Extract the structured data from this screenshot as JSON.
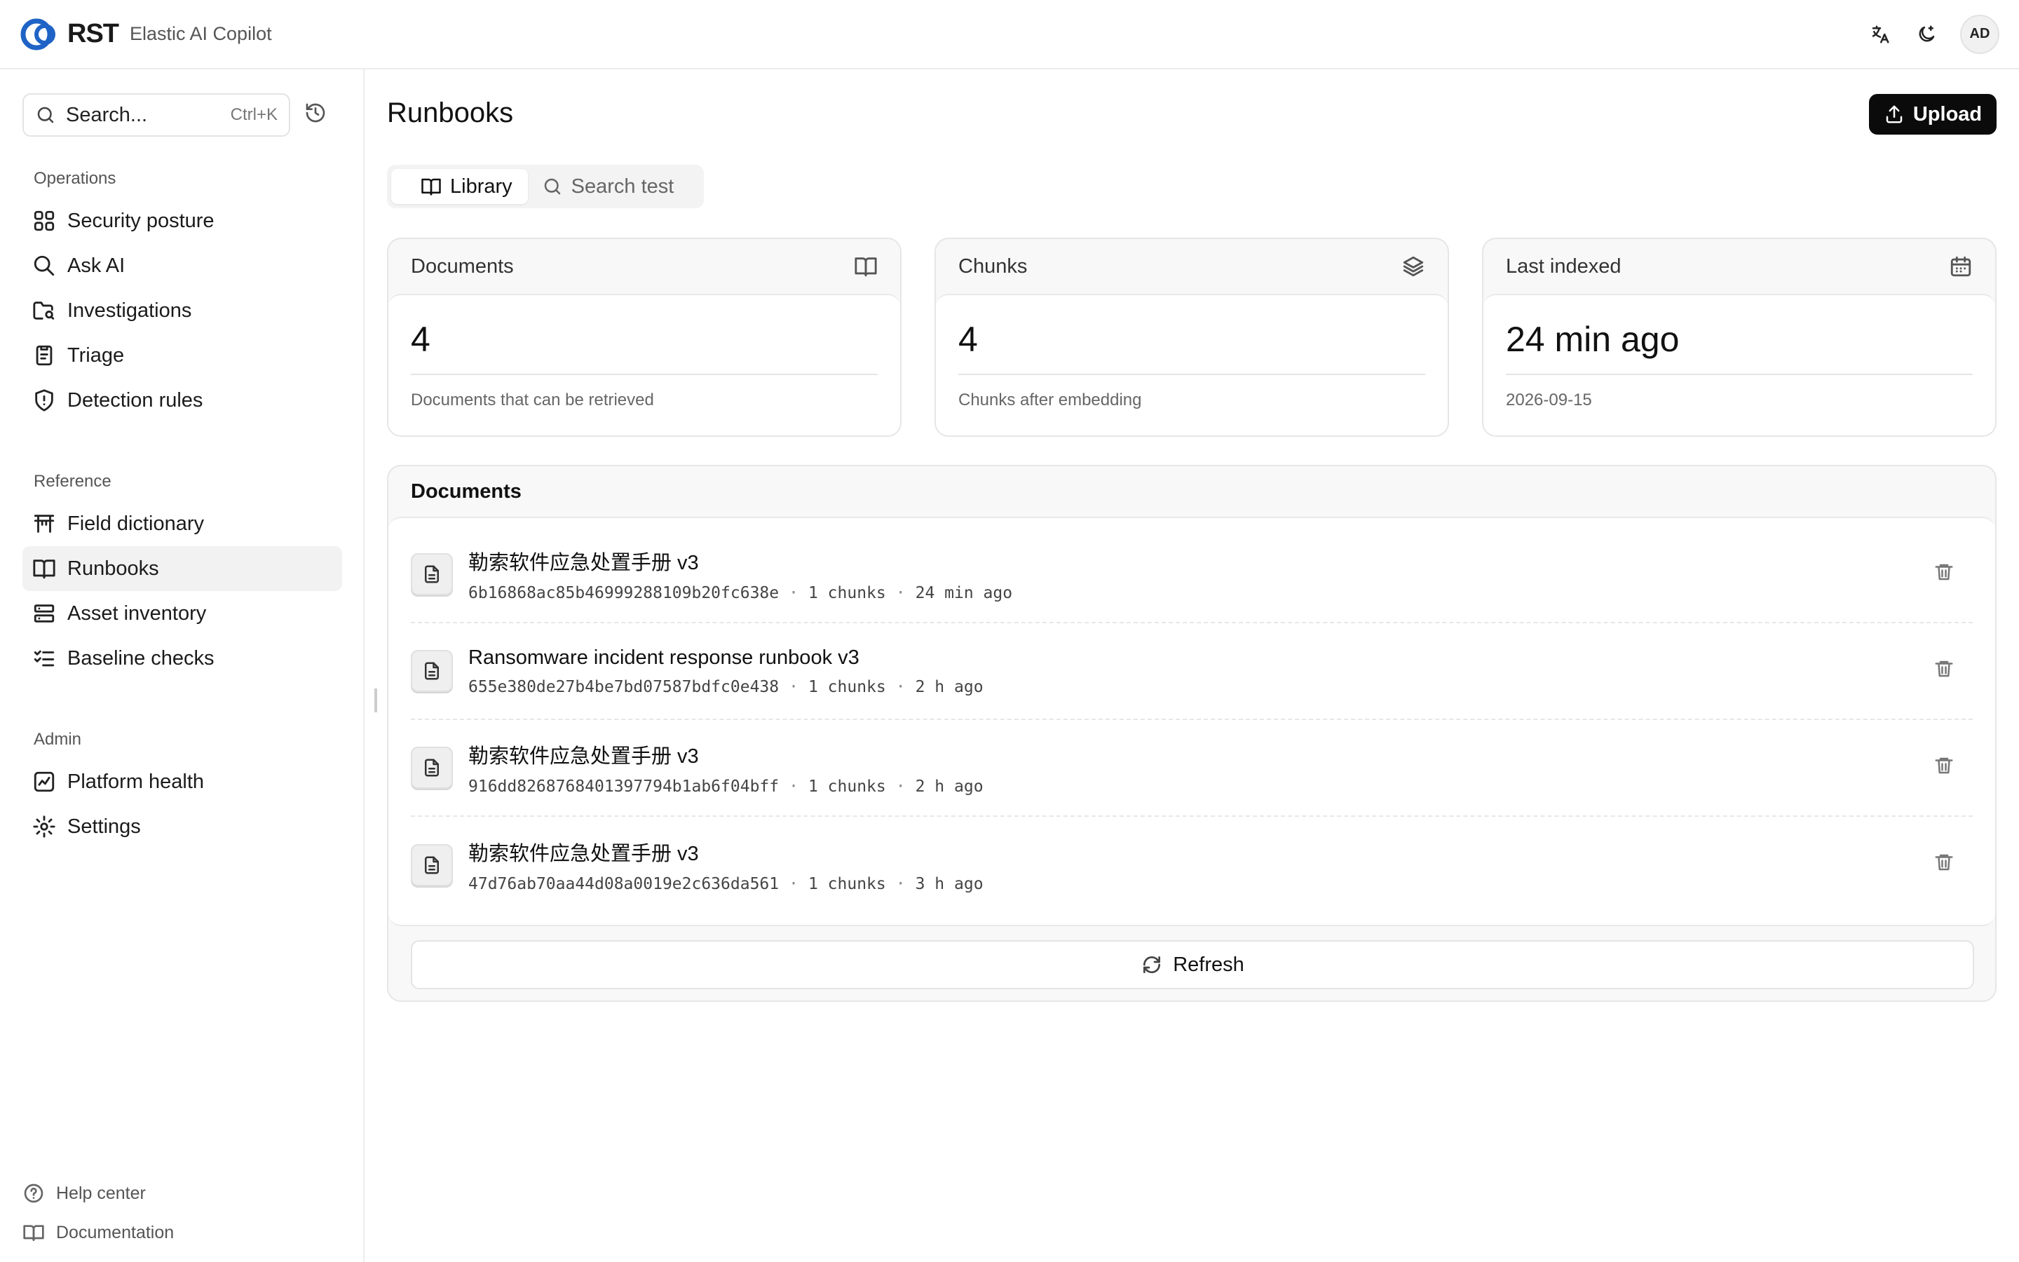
{
  "header": {
    "logo_text": "RST",
    "app_name": "Elastic AI Copilot",
    "avatar_initials": "AD",
    "icons": [
      "translate-icon",
      "theme-toggle-icon"
    ]
  },
  "sidebar": {
    "search": {
      "placeholder": "Search...",
      "shortcut": "Ctrl+K"
    },
    "sections": [
      {
        "title": "Operations",
        "items": [
          {
            "label": "Security posture",
            "icon": "grid-icon"
          },
          {
            "label": "Ask AI",
            "icon": "search-icon"
          },
          {
            "label": "Investigations",
            "icon": "folder-search-icon"
          },
          {
            "label": "Triage",
            "icon": "clipboard-icon"
          },
          {
            "label": "Detection rules",
            "icon": "shield-icon"
          }
        ]
      },
      {
        "title": "Reference",
        "items": [
          {
            "label": "Field dictionary",
            "icon": "table-icon"
          },
          {
            "label": "Runbooks",
            "icon": "book-open-icon",
            "active": true
          },
          {
            "label": "Asset inventory",
            "icon": "server-icon"
          },
          {
            "label": "Baseline checks",
            "icon": "list-checks-icon"
          }
        ]
      },
      {
        "title": "Admin",
        "items": [
          {
            "label": "Platform health",
            "icon": "chart-icon"
          },
          {
            "label": "Settings",
            "icon": "gear-icon"
          }
        ]
      }
    ],
    "footer": [
      {
        "label": "Help center",
        "icon": "help-circle-icon"
      },
      {
        "label": "Documentation",
        "icon": "book-icon"
      }
    ]
  },
  "main": {
    "title": "Runbooks",
    "upload_label": "Upload",
    "tabs": [
      {
        "label": "Library",
        "active": true
      },
      {
        "label": "Search test",
        "active": false
      }
    ],
    "stats": [
      {
        "title": "Documents",
        "value": "4",
        "sub": "Documents that can be retrieved",
        "icon": "book-open-icon"
      },
      {
        "title": "Chunks",
        "value": "4",
        "sub": "Chunks after embedding",
        "icon": "layers-icon"
      },
      {
        "title": "Last indexed",
        "value": "24 min ago",
        "sub": "2026-09-15",
        "icon": "calendar-icon"
      }
    ],
    "documents_title": "Documents",
    "documents": [
      {
        "title": "勒索软件应急处置手册 v3",
        "hash": "6b16868ac85b46999288109b20fc638e",
        "chunks": "1 chunks",
        "age": "24 min ago"
      },
      {
        "title": "Ransomware incident response runbook v3",
        "hash": "655e380de27b4be7bd07587bdfc0e438",
        "chunks": "1 chunks",
        "age": "2 h ago"
      },
      {
        "title": "勒索软件应急处置手册 v3",
        "hash": "916dd8268768401397794b1ab6f04bff",
        "chunks": "1 chunks",
        "age": "2 h ago"
      },
      {
        "title": "勒索软件应急处置手册 v3",
        "hash": "47d76ab70aa44d08a0019e2c636da561",
        "chunks": "1 chunks",
        "age": "3 h ago"
      }
    ],
    "meta_separator": "·",
    "refresh_label": "Refresh"
  }
}
